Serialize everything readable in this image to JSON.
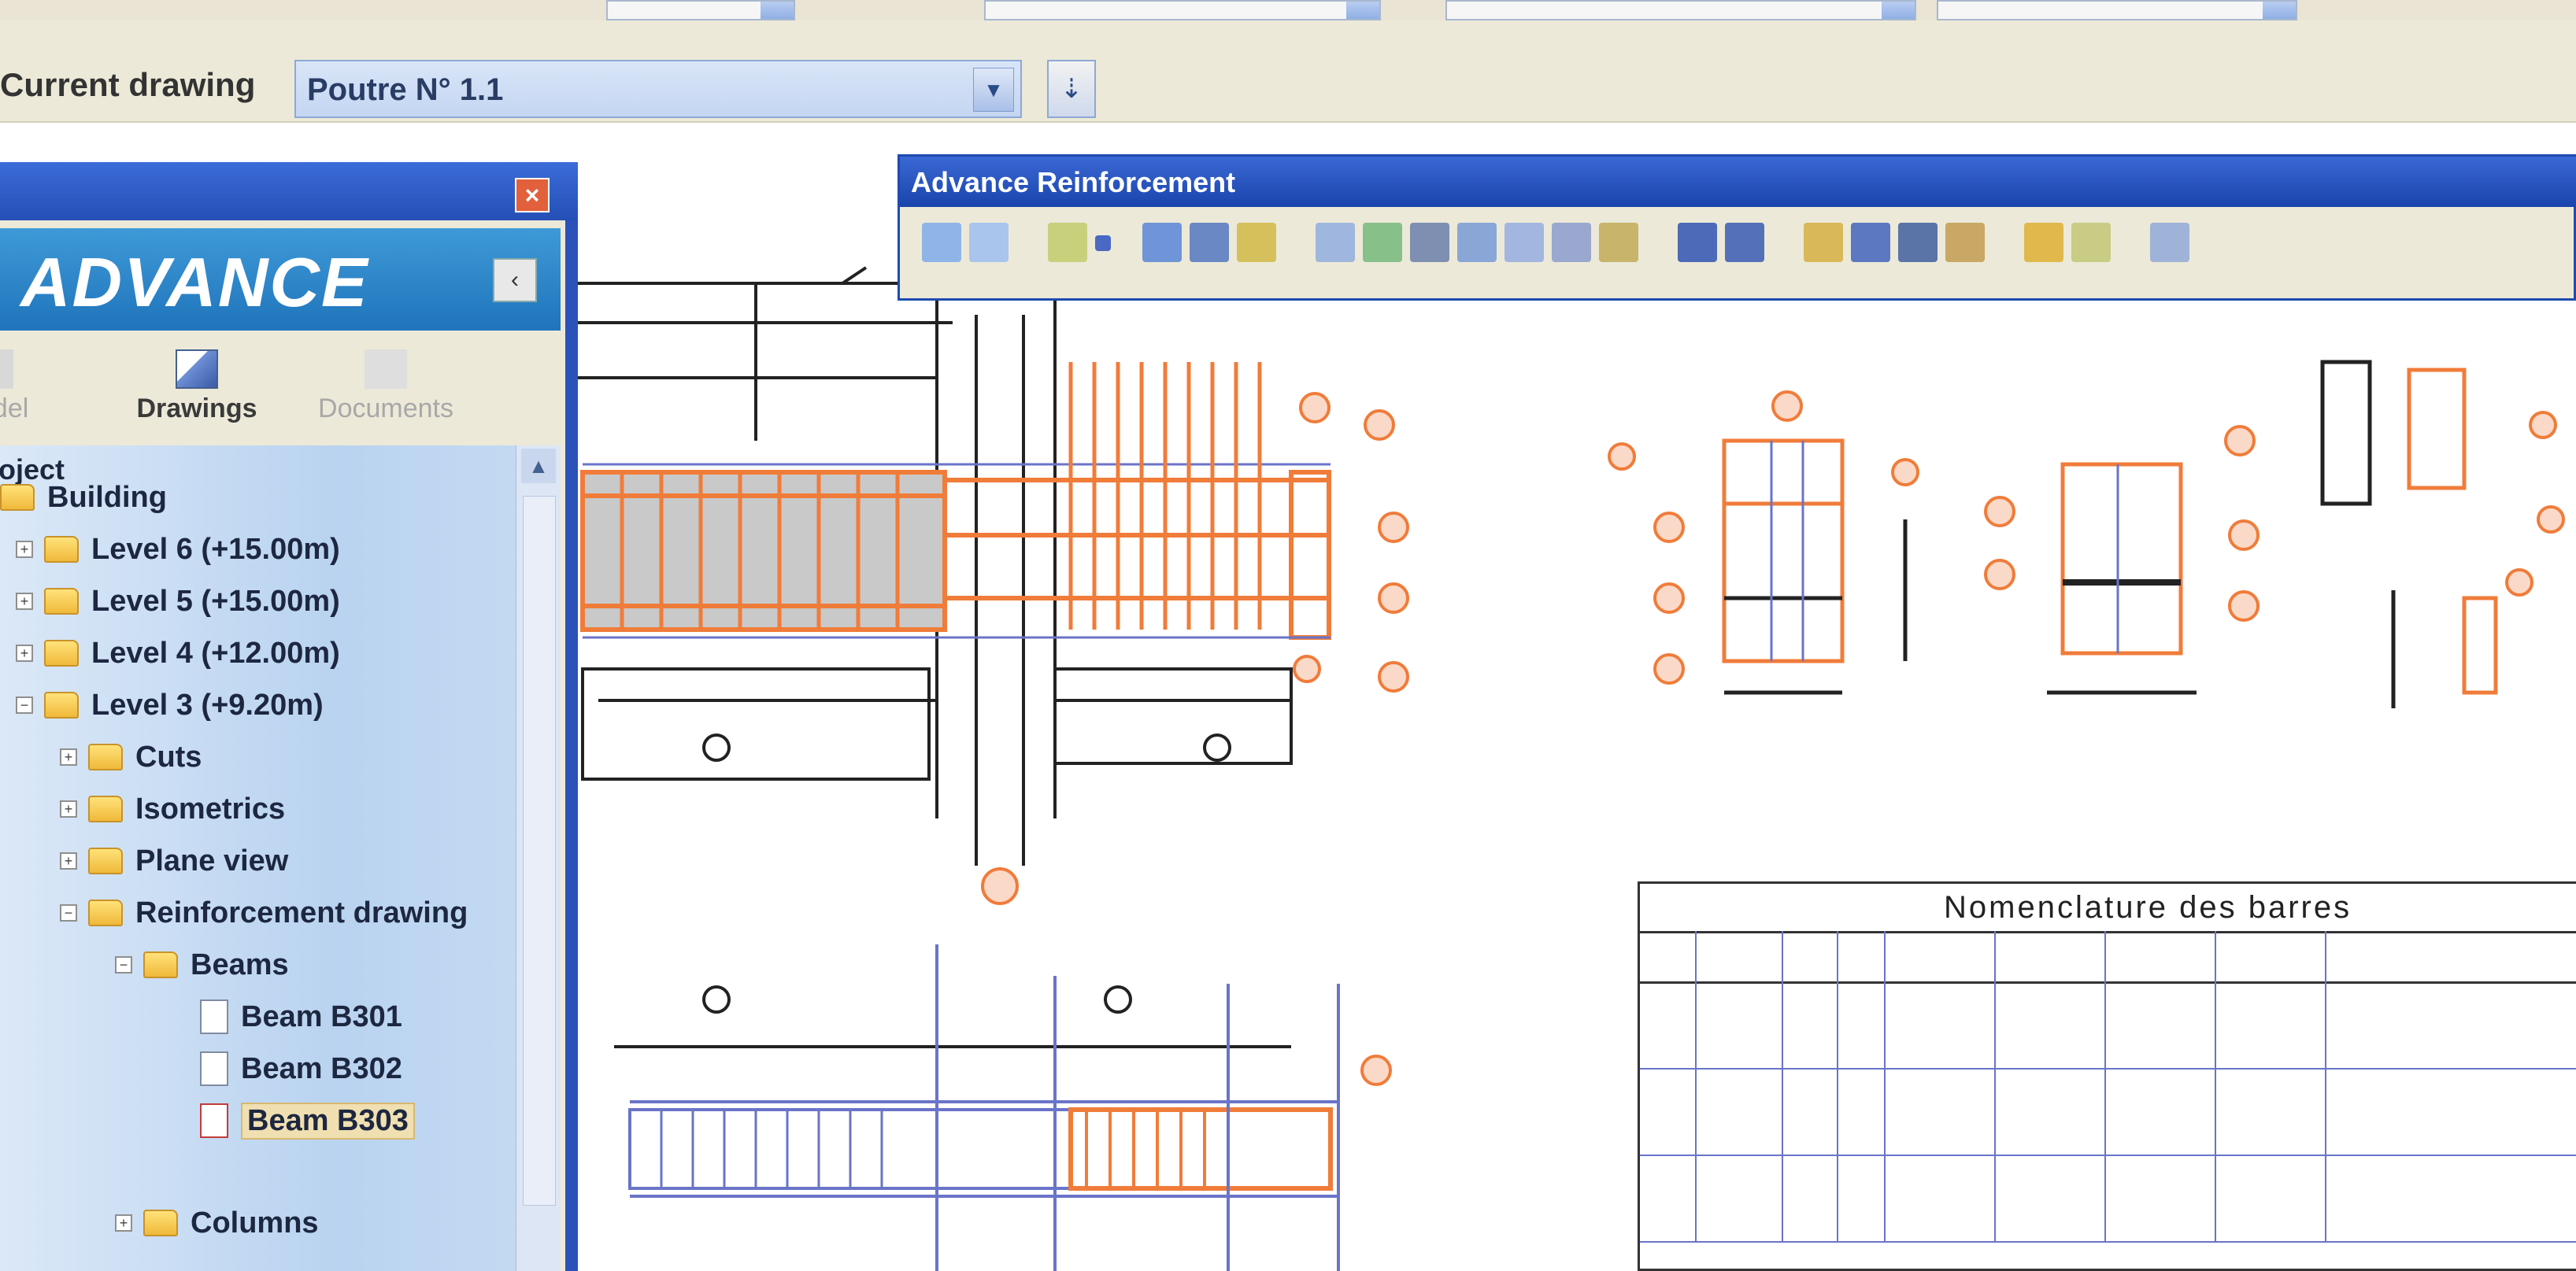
{
  "toolbar": {
    "current_drawing_label": "Current drawing",
    "current_drawing_value": "Poutre N° 1.1"
  },
  "panel": {
    "brand": "ADVANCE",
    "tabs": [
      {
        "label": "Model",
        "state": "inactive"
      },
      {
        "label": "Drawings",
        "state": "active"
      },
      {
        "label": "Documents",
        "state": "disabled"
      }
    ],
    "tree_root": "Project",
    "tree": [
      {
        "label": "Building",
        "level": 0,
        "kind": "folder"
      },
      {
        "label": "Level 6 (+15.00m)",
        "level": 1,
        "kind": "folder"
      },
      {
        "label": "Level 5 (+15.00m)",
        "level": 1,
        "kind": "folder"
      },
      {
        "label": "Level 4 (+12.00m)",
        "level": 1,
        "kind": "folder"
      },
      {
        "label": "Level 3 (+9.20m)",
        "level": 1,
        "kind": "folder"
      },
      {
        "label": "Cuts",
        "level": 2,
        "kind": "folder"
      },
      {
        "label": "Isometrics",
        "level": 2,
        "kind": "folder"
      },
      {
        "label": "Plane view",
        "level": 2,
        "kind": "folder"
      },
      {
        "label": "Reinforcement drawing",
        "level": 2,
        "kind": "folder"
      },
      {
        "label": "Beams",
        "level": 3,
        "kind": "folder"
      },
      {
        "label": "Beam B301",
        "level": 4,
        "kind": "doc"
      },
      {
        "label": "Beam B302",
        "level": 4,
        "kind": "doc"
      },
      {
        "label": "Beam B303",
        "level": 4,
        "kind": "doc",
        "selected": true
      },
      {
        "label": "Columns",
        "level": 3,
        "kind": "folder"
      }
    ]
  },
  "reinforcement_window": {
    "title": "Advance Reinforcement"
  },
  "schedule": {
    "title": "Nomenclature des barres"
  },
  "colors": {
    "rebar": "#f07c3a",
    "grid_blue": "#6a74c8",
    "titlebar": "#2450b6",
    "panel_bg": "#ece9d8"
  }
}
